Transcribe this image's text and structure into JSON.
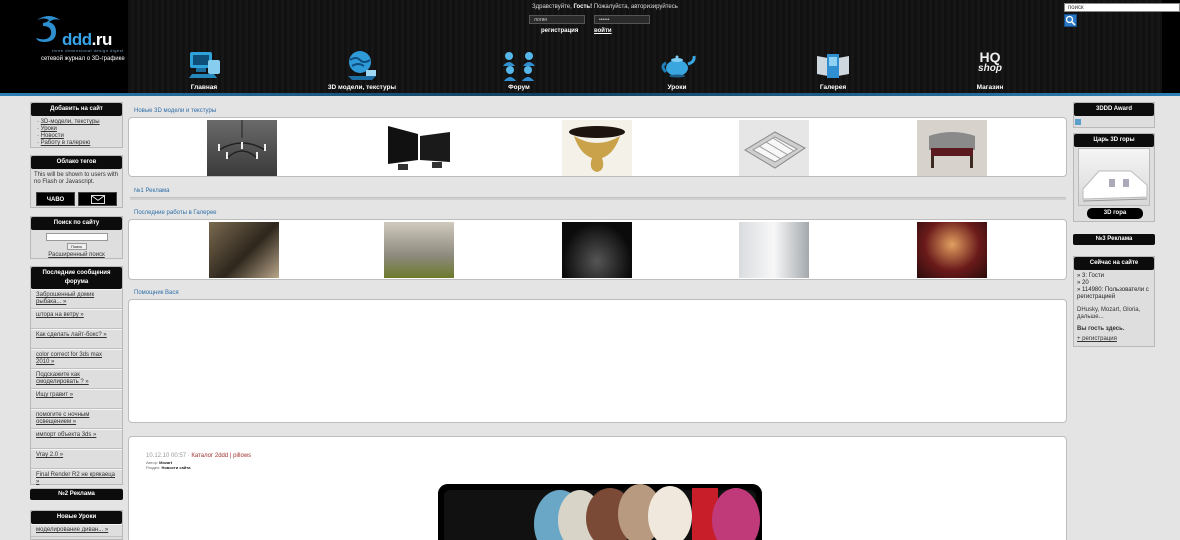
{
  "brand": {
    "logo_prefix": "3",
    "logo_name": "ddd",
    "logo_tld": ".ru",
    "tagline": "three dimensional design digest",
    "subtitle": "сетевой журнал о 3D-графике"
  },
  "auth": {
    "greeting_start": "Здравствуйте, ",
    "greeting_guest": "Гость!",
    "greeting_end": " Пожалуйста, авторизируйтесь",
    "login_value": "логин",
    "password_value": "••••••",
    "register_label": "регистрация",
    "signin_label": "войти"
  },
  "top_search": {
    "value": "поиск"
  },
  "nav": [
    {
      "label": "Главная",
      "icon": "home-monitor-icon"
    },
    {
      "label": "3D модели, текстуры",
      "icon": "globe-icon"
    },
    {
      "label": "Форум",
      "icon": "users-icon"
    },
    {
      "label": "Уроки",
      "icon": "teapot-icon"
    },
    {
      "label": "Галерея",
      "icon": "gallery-icon"
    },
    {
      "label": "Магазин",
      "icon": "hq-shop-icon",
      "logo_top": "HQ",
      "logo_bottom": "shop"
    }
  ],
  "left": {
    "add_title": "Добавить на сайт",
    "add_items": [
      "3D-модели, текстуры",
      "Уроки",
      "Новости",
      "Работу в галерею"
    ],
    "tags_title": "Облако тегов",
    "tags_text": "This will be shown to users with no Flash or Javascript.",
    "tags_faq": "ЧАВО",
    "search_title": "Поиск по сайту",
    "search_button": "Поиск",
    "search_advanced": "Расширенный поиск",
    "forum_title": "Последние сообщения форума",
    "forum_items": [
      "Заброшенный домик рыбака... »",
      "штора на ветру »",
      "Как сделать лайт-бокс? »",
      "color correct for 3ds max 2010 »",
      "Подскажите как смоделировать ? »",
      "Ищу гравит »",
      "помогите с ночным освещением »",
      "импорт объекта 3ds »",
      "Vray 2.0 »",
      "Final Render R2 не крякаеца »"
    ],
    "ad2_title": "№2 Реклама",
    "lessons_title": "Новые Уроки",
    "lessons_items": [
      "моделирование диван... »"
    ]
  },
  "main": {
    "models_label": "Новые 3D модели и текстуры",
    "ad1_label": "№1 Реклама",
    "gallery_label": "Последние работы в Галерее",
    "helper_label": "Помощник Вася",
    "news": {
      "date": "10.12.10 00:57",
      "separator": " · ",
      "title": "Каталог 2ddd | pillows",
      "author_label": "Автор: ",
      "author": "Mozart",
      "section_label": "Раздел: ",
      "section": "Новости сайта"
    }
  },
  "right": {
    "award_title": "3DDD Award",
    "king_title": "Царь 3D горы",
    "king_button": "3D гора",
    "ad3_title": "№3 Реклама",
    "online_title": "Сейчас на сайте",
    "online_items": [
      "3: Гости",
      "20",
      "114980: Пользователи с регистрацией"
    ],
    "online_users": "DHusky, Mozart, Gloria, дальше...",
    "you_are_guest": "Вы гость здесь.",
    "register_link": "+ регистрация"
  },
  "colors": {
    "header_bg": "#0a0a0a",
    "accent_blue": "#2d7fb4",
    "section_label": "#2e6ea8",
    "news_title": "#a13030"
  }
}
